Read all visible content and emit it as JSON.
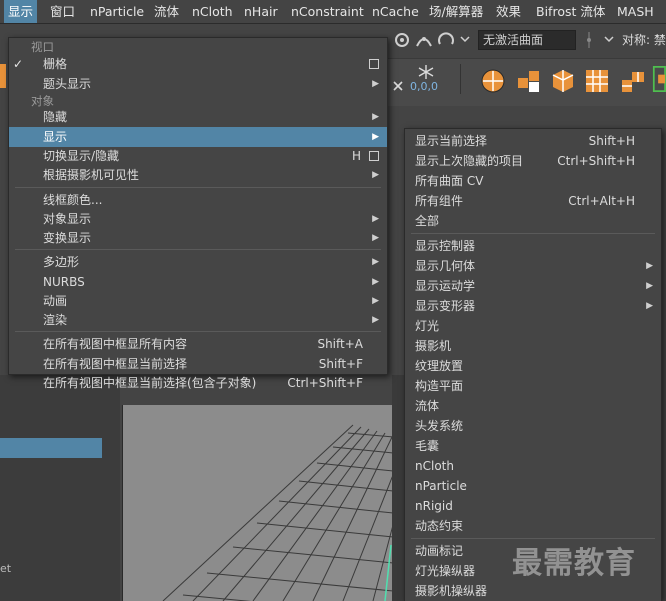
{
  "menubar": {
    "items": [
      "显示",
      "窗口",
      "nParticle",
      "流体",
      "nCloth",
      "nHair",
      "nConstraint",
      "nCache",
      "场/解算器",
      "效果",
      "Bifrost 流体",
      "MASH"
    ]
  },
  "toolbar": {
    "curve_field": "无激活曲面",
    "ref_label": "对称: 禁",
    "coords": "0,0,0"
  },
  "display_menu": {
    "section_viewport": "视口",
    "grid": "栅格",
    "hud": "题头显示",
    "section_object": "对象",
    "hide": "隐藏",
    "show": "显示",
    "toggle_show_hide": "切换显示/隐藏",
    "toggle_shortcut": "H",
    "by_camera": "根据摄影机可见性",
    "wireframe_color": "线框颜色...",
    "object_display": "对象显示",
    "transform_display": "变换显示",
    "polygon": "多边形",
    "nurbs": "NURBS",
    "animation": "动画",
    "render": "渲染",
    "frame_all": "在所有视图中框显所有内容",
    "frame_all_shortcut": "Shift+A",
    "frame_sel": "在所有视图中框显当前选择",
    "frame_sel_shortcut": "Shift+F",
    "frame_sel_children": "在所有视图中框显当前选择(包含子对象)",
    "frame_sel_children_shortcut": "Ctrl+Shift+F"
  },
  "show_submenu": {
    "items": [
      {
        "label": "显示当前选择",
        "shortcut": "Shift+H"
      },
      {
        "label": "显示上次隐藏的项目",
        "shortcut": "Ctrl+Shift+H"
      },
      {
        "label": "所有曲面 CV",
        "shortcut": ""
      },
      {
        "label": "所有组件",
        "shortcut": "Ctrl+Alt+H"
      },
      {
        "label": "全部",
        "shortcut": ""
      }
    ],
    "items2": [
      {
        "label": "显示控制器",
        "arrow": false
      },
      {
        "label": "显示几何体",
        "arrow": true
      },
      {
        "label": "显示运动学",
        "arrow": true
      },
      {
        "label": "显示变形器",
        "arrow": true
      },
      {
        "label": "灯光",
        "arrow": false
      },
      {
        "label": "摄影机",
        "arrow": false
      },
      {
        "label": "纹理放置",
        "arrow": false
      },
      {
        "label": "构造平面",
        "arrow": false
      },
      {
        "label": "流体",
        "arrow": false
      },
      {
        "label": "头发系统",
        "arrow": false
      },
      {
        "label": "毛囊",
        "arrow": false
      },
      {
        "label": "nCloth",
        "arrow": false
      },
      {
        "label": "nParticle",
        "arrow": false
      },
      {
        "label": "nRigid",
        "arrow": false
      },
      {
        "label": "动态约束",
        "arrow": false
      }
    ],
    "items3": [
      "动画标记",
      "灯光操纵器",
      "摄影机操纵器"
    ]
  },
  "left_panel": {
    "fragment": "et"
  },
  "watermark": "最需教育",
  "colors": {
    "highlight": "#5285a6",
    "menu_bg": "#454545",
    "accent_orange": "#e8923a"
  }
}
